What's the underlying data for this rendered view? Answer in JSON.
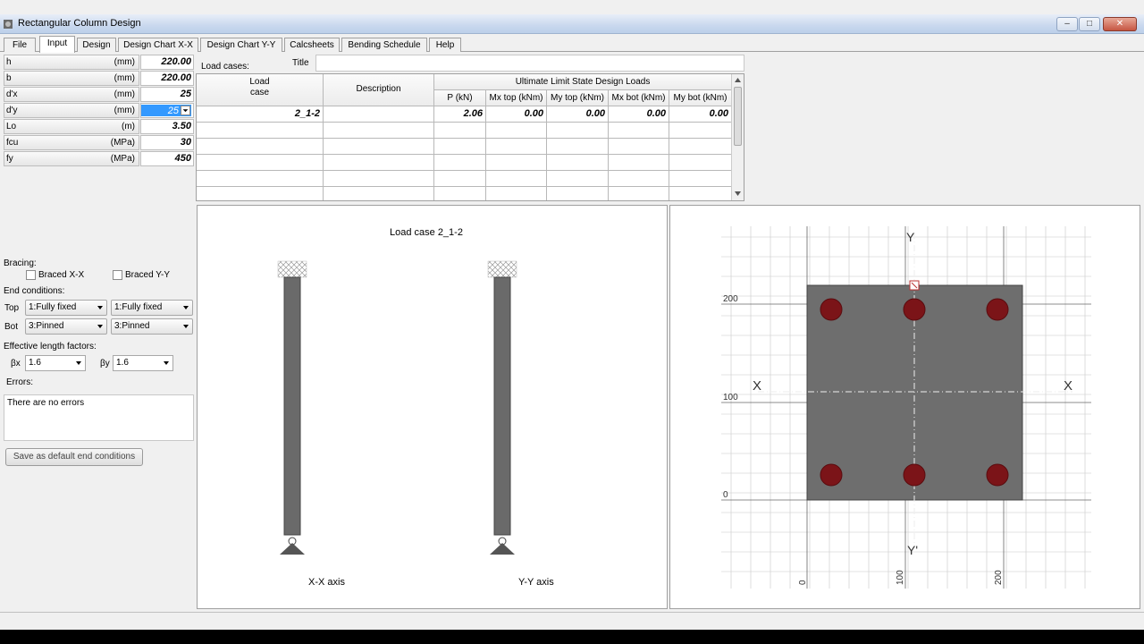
{
  "window": {
    "title": "Rectangular Column Design",
    "buttons": {
      "minimize": "–",
      "maximize": "□",
      "close": "✕"
    }
  },
  "tabs": [
    "File",
    "Input",
    "Design",
    "Design Chart X-X",
    "Design Chart Y-Y",
    "Calcsheets",
    "Bending Schedule",
    "Help"
  ],
  "properties": [
    {
      "label": "h",
      "unit": "(mm)",
      "value": "220.00"
    },
    {
      "label": "b",
      "unit": "(mm)",
      "value": "220.00"
    },
    {
      "label": "d'x",
      "unit": "(mm)",
      "value": "25"
    },
    {
      "label": "d'y",
      "unit": "(mm)",
      "value": "25"
    },
    {
      "label": "Lo",
      "unit": "(m)",
      "value": "3.50"
    },
    {
      "label": "fcu",
      "unit": "(MPa)",
      "value": "30"
    },
    {
      "label": "fy",
      "unit": "(MPa)",
      "value": "450"
    }
  ],
  "bracing": {
    "label": "Bracing:",
    "x": "Braced  X-X",
    "y": "Braced Y-Y"
  },
  "end_conditions": {
    "label": "End conditions:",
    "top_label": "Top",
    "bot_label": "Bot",
    "top_x": "1:Fully fixed",
    "top_y": "1:Fully fixed",
    "bot_x": "3:Pinned",
    "bot_y": "3:Pinned"
  },
  "effective_length": {
    "label": "Effective length factors:",
    "bx_label": "βx",
    "bx": "1.6",
    "by_label": "βy",
    "by": "1.6"
  },
  "errors": {
    "label": "Errors:",
    "text": "There are no errors"
  },
  "save_button": "Save as default end conditions",
  "load_cases": {
    "label": "Load cases:",
    "title_label": "Title",
    "group_header": "Ultimate Limit State Design Loads",
    "col_loadcase": "Load\ncase",
    "col_description": "Description",
    "columns": [
      "P  (kN)",
      "Mx top (kNm)",
      "My top (kNm)",
      "Mx bot (kNm)",
      "My bot (kNm)"
    ],
    "rows": [
      {
        "case": "2_1-2",
        "description": "",
        "values": [
          "2.06",
          "0.00",
          "0.00",
          "0.00",
          "0.00"
        ]
      }
    ]
  },
  "elevation": {
    "title": "Load case  2_1-2",
    "xx_label": "X-X axis",
    "yy_label": "Y-Y axis"
  },
  "section": {
    "axis_x": "X",
    "axis_y": "Y",
    "axis_y_prime": "Y'",
    "y_ticks": [
      "200",
      "100",
      "0"
    ],
    "x_ticks": [
      "0",
      "100",
      "200"
    ],
    "bar_color": "#7b1418",
    "concrete_color": "#6e6e6e"
  }
}
